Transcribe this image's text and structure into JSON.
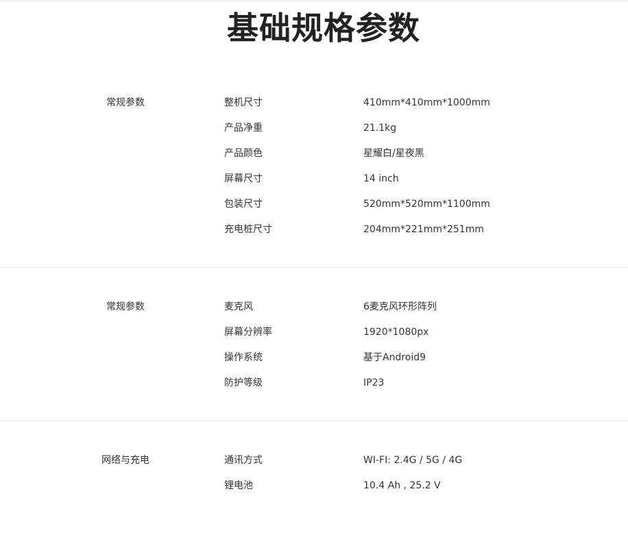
{
  "page": {
    "title": "基础规格参数"
  },
  "sections": [
    {
      "label": "常规参数",
      "rows": [
        {
          "key": "整机尺寸",
          "value": "410mm*410mm*1000mm"
        },
        {
          "key": "产品净重",
          "value": "21.1kg"
        },
        {
          "key": "产品颜色",
          "value": "星耀白/星夜黑"
        },
        {
          "key": "屏幕尺寸",
          "value": "14 inch"
        },
        {
          "key": "包装尺寸",
          "value": "520mm*520mm*1100mm"
        },
        {
          "key": "充电桩尺寸",
          "value": "204mm*221mm*251mm"
        }
      ]
    },
    {
      "label": "常规参数",
      "rows": [
        {
          "key": "麦克风",
          "value": "6麦克风环形阵列"
        },
        {
          "key": "屏幕分辨率",
          "value": "1920*1080px"
        },
        {
          "key": "操作系统",
          "value": "基于Android9"
        },
        {
          "key": "防护等级",
          "value": "IP23"
        }
      ]
    },
    {
      "label": "网络与充电",
      "rows": [
        {
          "key": "通讯方式",
          "value": "WI-FI: 2.4G / 5G / 4G"
        },
        {
          "key": "锂电池",
          "value": "10.4 Ah , 25.2 V"
        }
      ]
    }
  ]
}
